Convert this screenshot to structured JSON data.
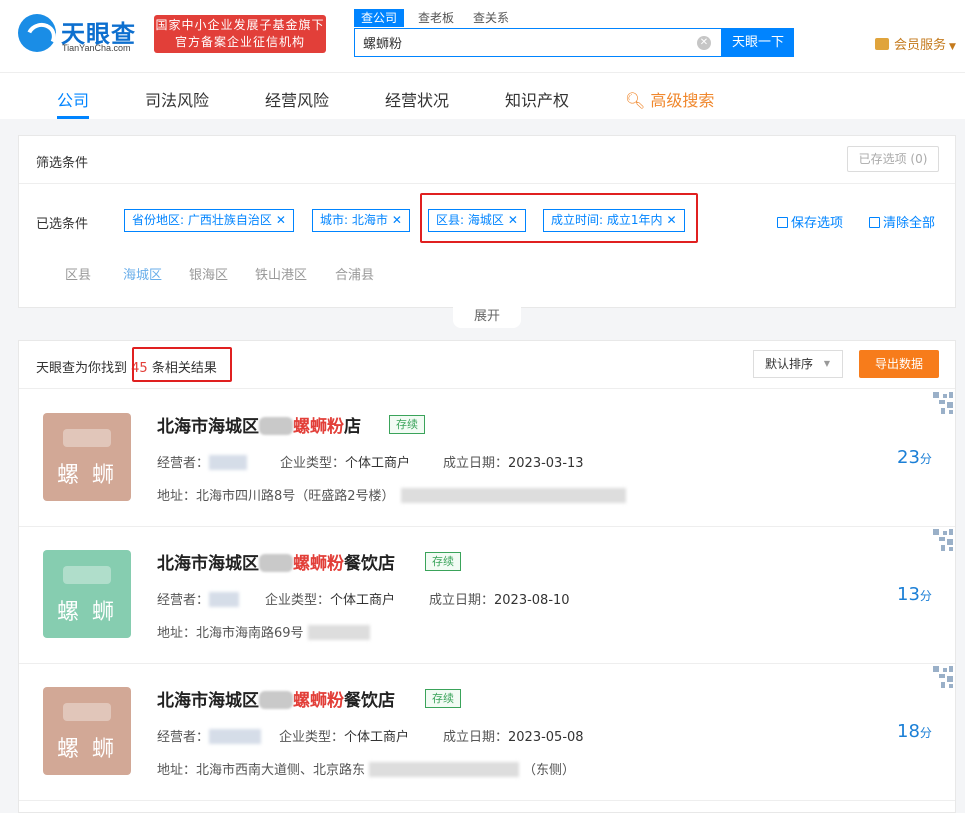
{
  "header": {
    "logo_text": "天眼查",
    "logo_sub": "TianYanCha.com",
    "badge_line1": "国家中小企业发展子基金旗下",
    "badge_line2": "官方备案企业征信机构",
    "search_tabs": [
      {
        "label": "查公司",
        "active": true
      },
      {
        "label": "查老板",
        "active": false
      },
      {
        "label": "查关系",
        "active": false
      }
    ],
    "search_value": "螺蛳粉",
    "search_button": "天眼一下",
    "vip_label": "会员服务"
  },
  "nav": {
    "items": [
      "公司",
      "司法风险",
      "经营风险",
      "经营状况",
      "知识产权"
    ],
    "advanced": "高级搜索"
  },
  "filter": {
    "title": "筛选条件",
    "saved_button": "已存选项 (0)",
    "selected_label": "已选条件",
    "chips": [
      "省份地区: 广西壮族自治区",
      "城市: 北海市",
      "区县: 海城区",
      "成立时间: 成立1年内"
    ],
    "save_option": "保存选项",
    "clear_all": "清除全部",
    "district_label": "区县",
    "districts": [
      "海城区",
      "银海区",
      "铁山港区",
      "合浦县"
    ],
    "expand": "展开"
  },
  "results": {
    "found_prefix": "天眼查为你找到",
    "count": "45",
    "found_suffix": "条相关结果",
    "sort_label": "默认排序",
    "export_label": "导出数据",
    "items": [
      {
        "avatar_text": "螺 蛳",
        "avatar_color": "#d2a896",
        "name_prefix": "北海市海城区",
        "name_hl": "螺蛳粉",
        "name_suffix": "店",
        "status": "存续",
        "operator_label": "经营者：",
        "type_label": "企业类型：",
        "type_value": "个体工商户",
        "date_label": "成立日期：",
        "date_value": "2023-03-13",
        "address_label": "地址：",
        "address_value": "北海市四川路8号（旺盛路2号楼）",
        "score": "23",
        "score_unit": "分"
      },
      {
        "avatar_text": "螺 蛳",
        "avatar_color": "#86cdb0",
        "name_prefix": "北海市海城区",
        "name_hl": "螺蛳粉",
        "name_suffix": "餐饮店",
        "status": "存续",
        "operator_label": "经营者：",
        "type_label": "企业类型：",
        "type_value": "个体工商户",
        "date_label": "成立日期：",
        "date_value": "2023-08-10",
        "address_label": "地址：",
        "address_value": "北海市海南路69号",
        "score": "13",
        "score_unit": "分"
      },
      {
        "avatar_text": "螺 蛳",
        "avatar_color": "#d2a896",
        "name_prefix": "北海市海城区",
        "name_hl": "螺蛳粉",
        "name_suffix": "餐饮店",
        "status": "存续",
        "operator_label": "经营者：",
        "type_label": "企业类型：",
        "type_value": "个体工商户",
        "date_label": "成立日期：",
        "date_value": "2023-05-08",
        "address_label": "地址：",
        "address_value": "北海市西南大道侧、北京路东",
        "address_tail": "（东侧）",
        "score": "18",
        "score_unit": "分"
      }
    ]
  },
  "colors": {
    "primary": "#0084ff",
    "highlight": "#e23f39",
    "export": "#f77c1b",
    "status_green": "#3aa35a"
  }
}
